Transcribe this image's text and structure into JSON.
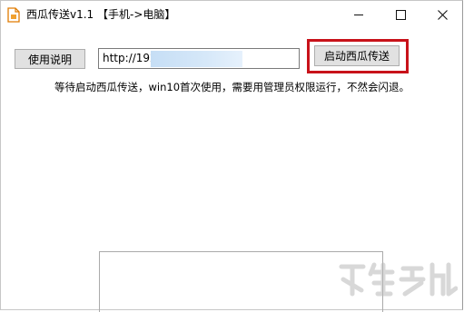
{
  "window": {
    "title": "西瓜传送v1.1 【手机->电脑】",
    "icon": "app-document-icon"
  },
  "controls": {
    "minimize_icon": "minimize-icon",
    "maximize_icon": "maximize-icon",
    "close_icon": "close-icon"
  },
  "toolbar": {
    "help_label": "使用说明",
    "url_value": "http://192",
    "start_label": "启动西瓜传送"
  },
  "hint_text": "等待启动西瓜传送，win10首次使用，需要用管理员权限运行，不然会闪退。",
  "log": {
    "value": ""
  },
  "colors": {
    "highlight": "#c8121a",
    "button_face": "#e1e1e1",
    "selection_mask": "#d6e8f9"
  }
}
